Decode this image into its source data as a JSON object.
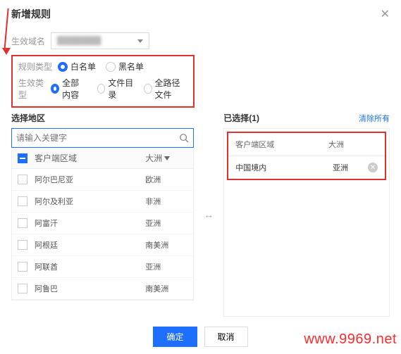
{
  "header": {
    "title": "新增规则"
  },
  "domain_row": {
    "label": "生效域名",
    "value_placeholder": "████████"
  },
  "rule_type": {
    "label": "规则类型",
    "options": {
      "white": "白名单",
      "black": "黑名单"
    },
    "selected": "white"
  },
  "scope_type": {
    "label": "生效类型",
    "options": {
      "all": "全部内容",
      "dir": "文件目录",
      "path": "全路径文件"
    },
    "selected": "all"
  },
  "left": {
    "title": "选择地区",
    "search_placeholder": "请输入关键字",
    "header": {
      "client": "客户端区域",
      "continent": "大洲"
    },
    "items": [
      {
        "name": "阿尔巴尼亚",
        "continent": "欧洲"
      },
      {
        "name": "阿尔及利亚",
        "continent": "非洲"
      },
      {
        "name": "阿富汗",
        "continent": "亚洲"
      },
      {
        "name": "阿根廷",
        "continent": "南美洲"
      },
      {
        "name": "阿联酋",
        "continent": "亚洲"
      },
      {
        "name": "阿鲁巴",
        "continent": "南美洲"
      }
    ]
  },
  "right": {
    "title": "已选择(1)",
    "clear": "清除所有",
    "header": {
      "client": "客户端区域",
      "continent": "大洲"
    },
    "items": [
      {
        "name": "中国境内",
        "continent": "亚洲"
      }
    ]
  },
  "footer": {
    "confirm": "确定",
    "cancel": "取消"
  },
  "watermark": "www.9969.net"
}
